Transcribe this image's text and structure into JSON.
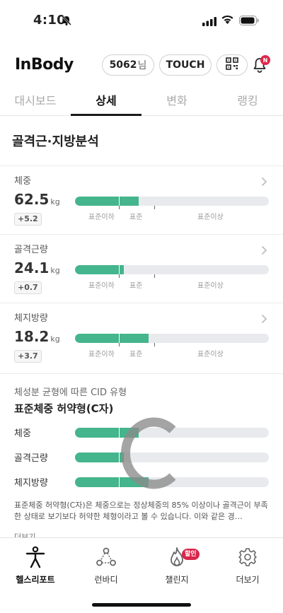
{
  "status_bar": {
    "time": "4:10"
  },
  "header": {
    "logo": "InBody",
    "user_id": "5062",
    "user_suffix": "님",
    "touch_label": "TOUCH",
    "notification_badge": "N"
  },
  "tabs": [
    {
      "label": "대시보드",
      "active": false
    },
    {
      "label": "상세",
      "active": true
    },
    {
      "label": "변화",
      "active": false
    },
    {
      "label": "랭킹",
      "active": false
    }
  ],
  "section_title": "골격근·지방분석",
  "metrics": [
    {
      "label": "체중",
      "value": "62.5",
      "unit": "kg",
      "delta": "+5.2",
      "level": 0.33
    },
    {
      "label": "골격근량",
      "value": "24.1",
      "unit": "kg",
      "delta": "+0.7",
      "level": 0.25
    },
    {
      "label": "체지방량",
      "value": "18.2",
      "unit": "kg",
      "delta": "+3.7",
      "level": 0.38
    }
  ],
  "scale_labels": [
    "표준이하",
    "표준",
    "표준이상"
  ],
  "cid": {
    "subtitle": "체성분 균형에 따른 CID 유형",
    "type": "표준체중 허약형(C자)",
    "letter": "C",
    "rows": [
      {
        "label": "체중",
        "level": 0.33
      },
      {
        "label": "골격근량",
        "level": 0.25
      },
      {
        "label": "체지방량",
        "level": 0.38
      }
    ],
    "description": "표준체중 허약형(C자)은 체중으로는 정상체중의 85% 이상이나 골격근이 부족한 상태로 보기보다 허약한 체형이라고 볼 수 있습니다. 이와 같은 경…",
    "more": "더보기 ⌄"
  },
  "bottom_nav": [
    {
      "label": "헬스리포트",
      "icon": "health-report-icon",
      "active": true
    },
    {
      "label": "런바디",
      "icon": "runbody-icon",
      "active": false
    },
    {
      "label": "챌린지",
      "icon": "flame-icon",
      "active": false,
      "badge": "할인"
    },
    {
      "label": "더보기",
      "icon": "gear-icon",
      "active": false
    }
  ],
  "colors": {
    "accent": "#44b58c",
    "bar_bg": "#e8eaee",
    "badge": "#d9264a"
  }
}
